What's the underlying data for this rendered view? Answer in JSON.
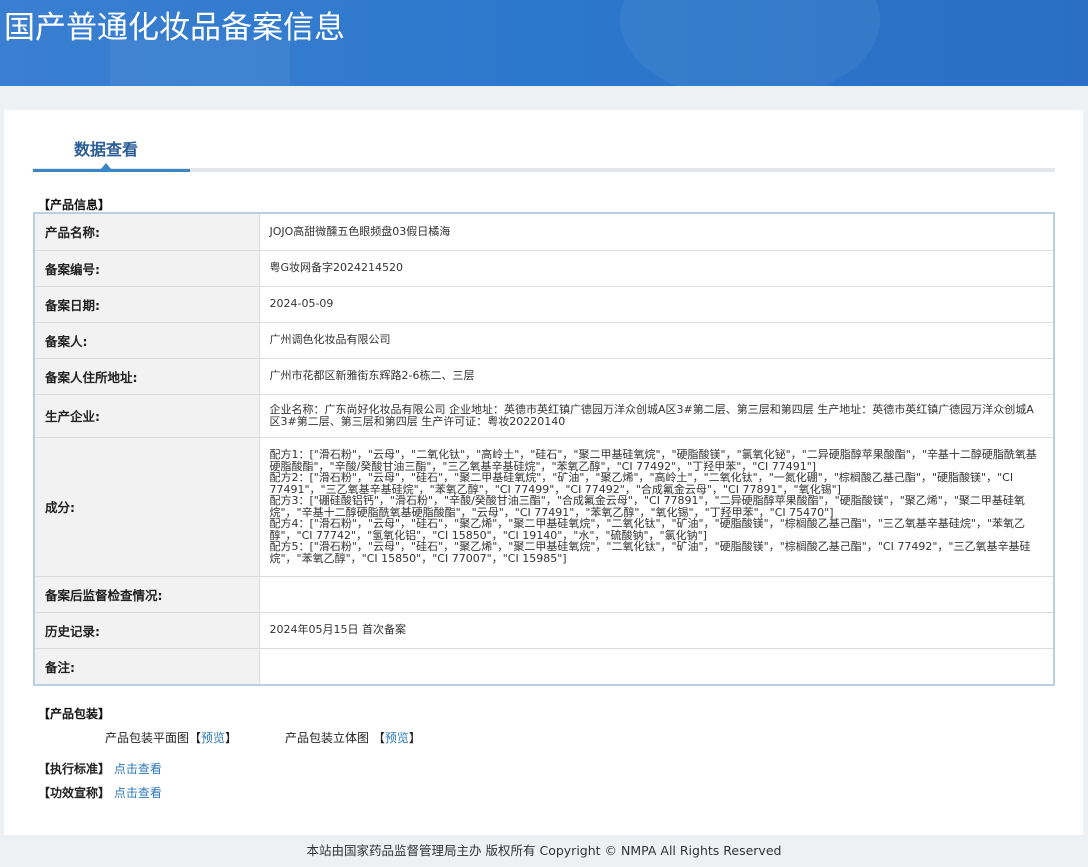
{
  "header": {
    "title": "国产普通化妆品备案信息"
  },
  "tab": {
    "label": "数据查看"
  },
  "product_info": {
    "section_title": "【产品信息】",
    "rows": [
      {
        "label": "产品名称:",
        "value": "JOJO高甜微醺五色眼频盘03假日橘海"
      },
      {
        "label": "备案编号:",
        "value": "粤G妆网备字2024214520"
      },
      {
        "label": "备案日期:",
        "value": "2024-05-09"
      },
      {
        "label": "备案人:",
        "value": "广州调色化妆品有限公司"
      },
      {
        "label": "备案人住所地址:",
        "value": "广州市花都区新雅街东辉路2-6栋二、三层"
      },
      {
        "label": "生产企业:",
        "value": "企业名称：广东尚好化妆品有限公司 企业地址：英德市英红镇广德园万洋众创城A区3#第二层、第三层和第四层 生产地址：英德市英红镇广德园万洋众创城A区3#第二层、第三层和第四层 生产许可证：粤妆20220140"
      },
      {
        "label": "成分:",
        "formulas": [
          "配方1：[\"滑石粉\"，\"云母\"，\"二氧化钛\"，\"高岭土\"，\"硅石\"，\"聚二甲基硅氧烷\"，\"硬脂酸镁\"，\"氯氧化铋\"，\"二异硬脂醇苹果酸酯\"，\"辛基十二醇硬脂酰氧基硬脂酸酯\"，\"辛酸/癸酸甘油三酯\"，\"三乙氧基辛基硅烷\"，\"苯氧乙醇\"，\"CI 77492\"，\"丁羟甲苯\"，\"CI 77491\"]",
          "配方2：[\"滑石粉\"，\"云母\"，\"硅石\"，\"聚二甲基硅氧烷\"，\"矿油\"，\"聚乙烯\"，\"高岭土\"，\"二氧化钛\"，\"一氮化硼\"，\"棕榈酸乙基己酯\"，\"硬脂酸镁\"，\"CI 77491\"，\"三乙氧基辛基硅烷\"，\"苯氧乙醇\"，\"CI 77499\"，\"CI 77492\"，\"合成氟金云母\"，\"CI 77891\"，\"氧化锡\"]",
          "配方3：[\"硼硅酸铝钙\"，\"滑石粉\"，\"辛酸/癸酸甘油三酯\"，\"合成氟金云母\"，\"CI 77891\"，\"二异硬脂醇苹果酸酯\"，\"硬脂酸镁\"，\"聚乙烯\"，\"聚二甲基硅氧烷\"，\"辛基十二醇硬脂酰氧基硬脂酸酯\"，\"云母\"，\"CI 77491\"，\"苯氧乙醇\"，\"氧化锡\"，\"丁羟甲苯\"，\"CI 75470\"]",
          "配方4：[\"滑石粉\"，\"云母\"，\"硅石\"，\"聚乙烯\"，\"聚二甲基硅氧烷\"，\"二氧化钛\"，\"矿油\"，\"硬脂酸镁\"，\"棕榈酸乙基己酯\"，\"三乙氧基辛基硅烷\"，\"苯氧乙醇\"，\"CI 77742\"，\"氢氧化铝\"，\"CI 15850\"，\"CI 19140\"，\"水\"，\"硫酸钠\"，\"氯化钠\"]",
          "配方5：[\"滑石粉\"，\"云母\"，\"硅石\"，\"聚乙烯\"，\"聚二甲基硅氧烷\"，\"二氧化钛\"，\"矿油\"，\"硬脂酸镁\"，\"棕榈酸乙基己酯\"，\"CI 77492\"，\"三乙氧基辛基硅烷\"，\"苯氧乙醇\"，\"CI 15850\"，\"CI 77007\"，\"CI 15985\"]"
        ]
      },
      {
        "label": "备案后监督检查情况:",
        "value": ""
      },
      {
        "label": "历史记录:",
        "value": "2024年05月15日 首次备案"
      },
      {
        "label": "备注:",
        "value": ""
      }
    ]
  },
  "packaging": {
    "section_title": "【产品包装】",
    "flat_label": "产品包装平面图",
    "flat_link": "预览",
    "solid_label": "产品包装立体图",
    "solid_link": "预览",
    "bracket_open": "【",
    "bracket_close": "】"
  },
  "standard": {
    "label": "【执行标准】",
    "link": "点击查看"
  },
  "efficacy": {
    "label": "【功效宣称】",
    "link": "点击查看"
  },
  "footer": {
    "text": "本站由国家药品监督管理局主办 版权所有 Copyright © NMPA All Rights Reserved"
  }
}
